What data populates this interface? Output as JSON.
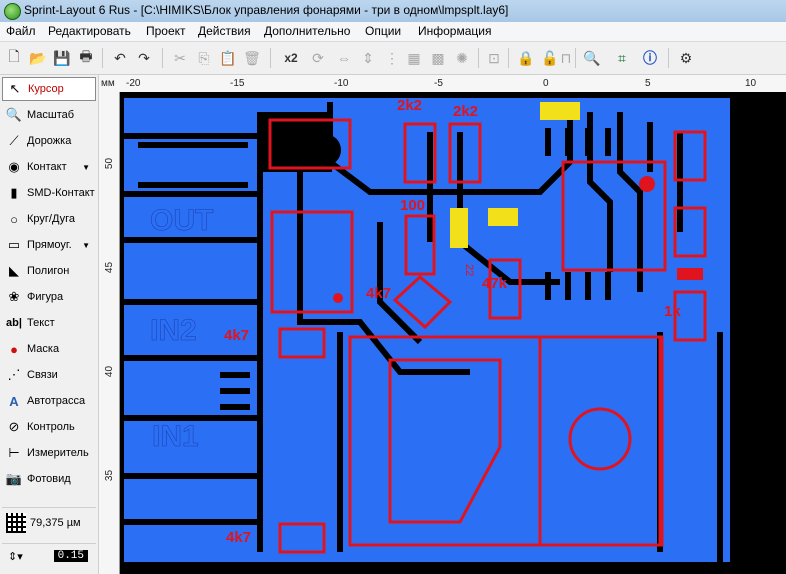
{
  "window": {
    "title": "Sprint-Layout 6 Rus - [C:\\HIMIKS\\Блок управления фонарями - три в одном\\lmpsplt.lay6]"
  },
  "menu": [
    "Файл",
    "Редактировать",
    "Проект",
    "Действия",
    "Дополнительно",
    "Опции",
    "Информация"
  ],
  "toolbar": {
    "icons": [
      "new-icon",
      "open-icon",
      "save-icon",
      "print-icon",
      "undo-icon",
      "redo-icon",
      "cut-icon",
      "copy-icon",
      "paste-icon",
      "delete-icon",
      "duplicate-icon",
      "rotate-icon",
      "mirror-h-icon",
      "mirror-v-icon",
      "align-icon",
      "group-icon",
      "ungroup-icon",
      "component-icon",
      "lock-icon",
      "unlock-icon",
      "zoom-icon",
      "crop-icon",
      "info-icon",
      "gear-icon"
    ],
    "multiply_label": "x2"
  },
  "sidebar": {
    "tools": [
      {
        "label": "Курсор",
        "icon": "cursor-icon",
        "selected": true
      },
      {
        "label": "Масштаб",
        "icon": "magnifier-icon"
      },
      {
        "label": "Дорожка",
        "icon": "track-icon"
      },
      {
        "label": "Контакт",
        "icon": "pad-icon",
        "dropdown": true
      },
      {
        "label": "SMD-Контакт",
        "icon": "smd-pad-icon"
      },
      {
        "label": "Круг/Дуга",
        "icon": "circle-icon"
      },
      {
        "label": "Прямоуг.",
        "icon": "rectangle-icon",
        "dropdown": true
      },
      {
        "label": "Полигон",
        "icon": "polygon-icon"
      },
      {
        "label": "Фигура",
        "icon": "figure-icon"
      },
      {
        "label": "Текст",
        "icon": "text-icon"
      },
      {
        "label": "Маска",
        "icon": "mask-icon"
      },
      {
        "label": "Связи",
        "icon": "connections-icon"
      },
      {
        "label": "Автотрасса",
        "icon": "autoroute-icon"
      },
      {
        "label": "Контроль",
        "icon": "check-icon"
      },
      {
        "label": "Измеритель",
        "icon": "measure-icon"
      },
      {
        "label": "Фотовид",
        "icon": "photoview-icon"
      }
    ],
    "grid_value": "79,375 µм",
    "track_width": "0.15"
  },
  "rulers": {
    "unit": "мм",
    "top": [
      "-20",
      "-15",
      "-10",
      "-5",
      "0",
      "5",
      "10"
    ],
    "left": [
      "50",
      "45",
      "40",
      "35"
    ]
  },
  "pcb": {
    "labels": {
      "out": "OUT",
      "in2": "IN2",
      "in1": "IN1",
      "r1": "2k2",
      "r2": "2k2",
      "r3": "100",
      "r4": "4k7",
      "r5": "47k",
      "r6": "1k",
      "r7": "4k7",
      "r8": "4k7",
      "r9": "22"
    },
    "colors": {
      "background": "#000000",
      "copper": "#2b6ff5",
      "silk": "#e0141e",
      "pad_yellow": "#f2e01a"
    }
  }
}
